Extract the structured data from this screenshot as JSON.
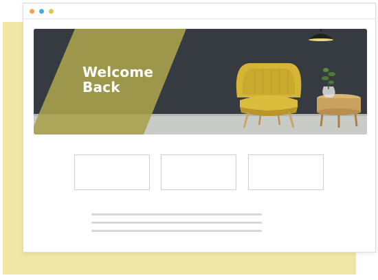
{
  "colors": {
    "backdrop": "#f0e7a7",
    "window_bg": "#ffffff",
    "dot_red": "#f5a24b",
    "dot_blue": "#4aa8e0",
    "dot_yellow": "#d9c653",
    "hero_wall": "#3a3f44",
    "hero_overlay": "#a8a24e",
    "chair": "#d6b436",
    "placeholder_border": "#cfcfcf",
    "text_line": "#d6d6d6"
  },
  "window": {
    "controls": [
      "close-dot",
      "minimize-dot",
      "maximize-dot"
    ]
  },
  "hero": {
    "title_line1": "Welcome",
    "title_line2": "Back"
  },
  "cards": [
    "",
    "",
    ""
  ],
  "text_lines": 3
}
